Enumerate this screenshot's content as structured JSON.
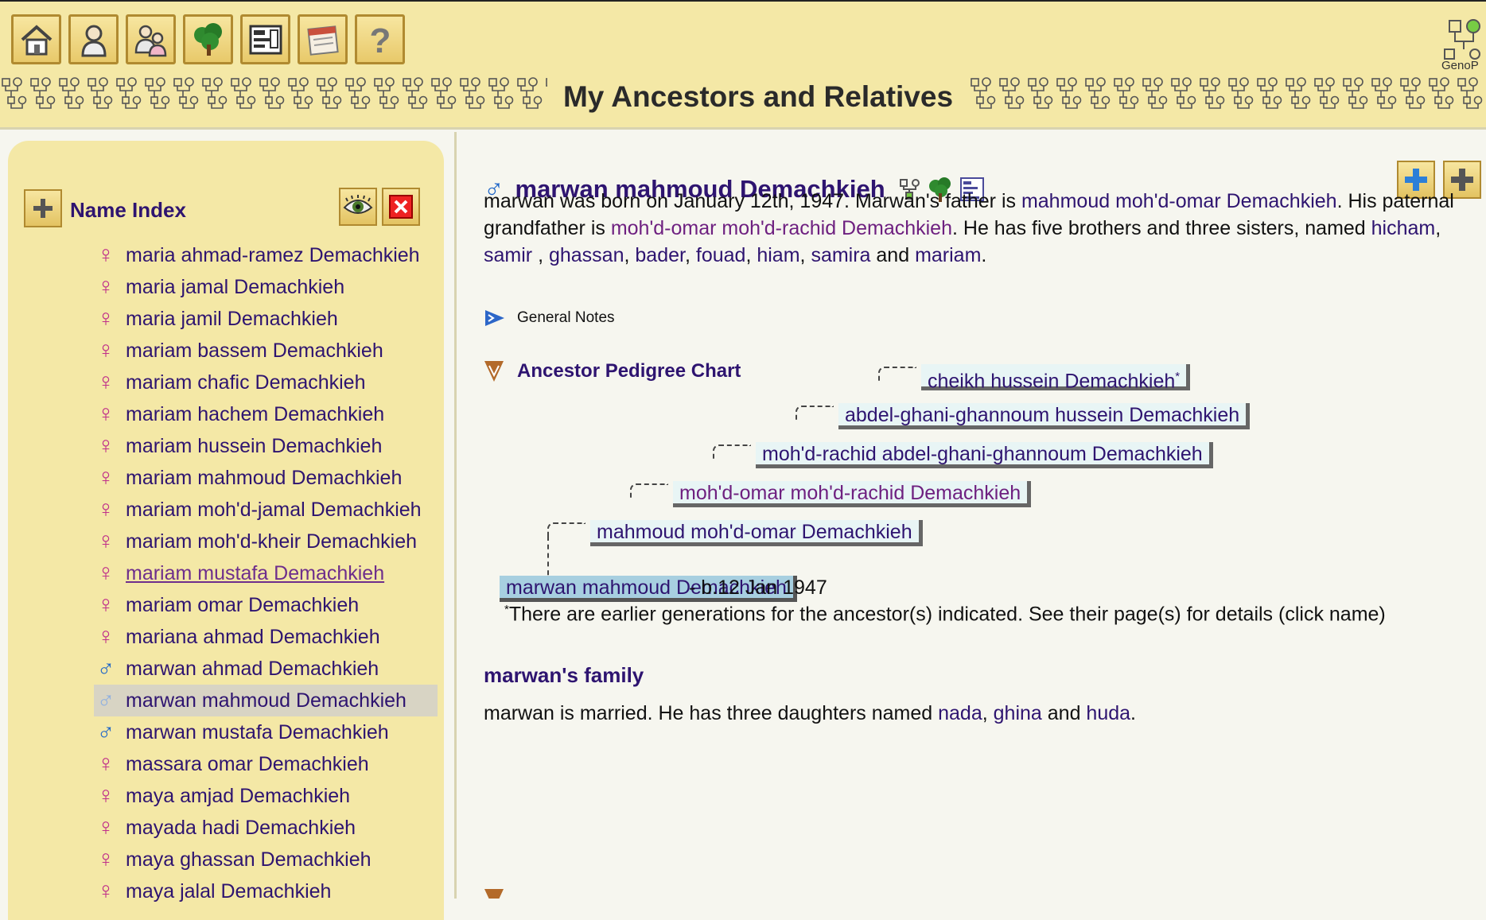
{
  "toolbar": {
    "buttons": [
      {
        "icon": "home-icon",
        "name": "toolbar-home-button"
      },
      {
        "icon": "person-icon",
        "name": "toolbar-individuals-button"
      },
      {
        "icon": "family-icon",
        "name": "toolbar-families-button"
      },
      {
        "icon": "tree-icon",
        "name": "toolbar-tree-button"
      },
      {
        "icon": "chart-icon",
        "name": "toolbar-charts-button"
      },
      {
        "icon": "calendar-icon",
        "name": "toolbar-calendar-button"
      },
      {
        "icon": "help-icon",
        "name": "toolbar-help-button"
      }
    ]
  },
  "header": {
    "title": "My Ancestors and Relatives",
    "logo_text": "GenoP"
  },
  "sidebar": {
    "title": "Name Index",
    "entries": [
      {
        "name": "maria ahmad-ramez Demachkieh",
        "gender": "f"
      },
      {
        "name": "maria jamal Demachkieh",
        "gender": "f"
      },
      {
        "name": "maria jamil Demachkieh",
        "gender": "f"
      },
      {
        "name": "mariam bassem Demachkieh",
        "gender": "f"
      },
      {
        "name": "mariam chafic Demachkieh",
        "gender": "f"
      },
      {
        "name": "mariam hachem Demachkieh",
        "gender": "f"
      },
      {
        "name": "mariam hussein Demachkieh",
        "gender": "f"
      },
      {
        "name": "mariam mahmoud Demachkieh",
        "gender": "f"
      },
      {
        "name": "mariam moh'd-jamal Demachkieh",
        "gender": "f"
      },
      {
        "name": "mariam moh'd-kheir Demachkieh",
        "gender": "f"
      },
      {
        "name": "mariam mustafa Demachkieh",
        "gender": "f",
        "state": "hover"
      },
      {
        "name": "mariam omar Demachkieh",
        "gender": "f"
      },
      {
        "name": "mariana ahmad Demachkieh",
        "gender": "f"
      },
      {
        "name": "marwan ahmad Demachkieh",
        "gender": "m"
      },
      {
        "name": "marwan mahmoud Demachkieh",
        "gender": "m",
        "state": "selected"
      },
      {
        "name": "marwan mustafa Demachkieh",
        "gender": "m"
      },
      {
        "name": "massara omar Demachkieh",
        "gender": "f"
      },
      {
        "name": "maya amjad Demachkieh",
        "gender": "f"
      },
      {
        "name": "mayada hadi Demachkieh",
        "gender": "f"
      },
      {
        "name": "maya ghassan Demachkieh",
        "gender": "f"
      },
      {
        "name": "maya jalal Demachkieh",
        "gender": "f"
      }
    ]
  },
  "person": {
    "gender_symbol": "♂",
    "name": "marwan mahmoud Demachkieh",
    "bio": {
      "t1": "marwan was born on January 12th, 1947.  Marwan's father is ",
      "father": "mahmoud moh'd-omar Demachkieh",
      "t2": ".  His paternal grandfather is ",
      "grandfather": "moh'd-omar moh'd-rachid Demachkieh",
      "t3": ". He has five brothers and three sisters, named ",
      "siblings": [
        "hicham",
        "samir ",
        "ghassan",
        "bader",
        "fouad",
        "hiam",
        "samira",
        "mariam"
      ],
      "and": "and",
      "end": "."
    }
  },
  "general_notes": {
    "label": "General Notes"
  },
  "pedigree": {
    "title": "Ancestor Pedigree Chart",
    "generations": [
      {
        "name": "cheikh hussein Demachkieh",
        "marker": "*"
      },
      {
        "name": "abdel-ghani-ghannoum hussein Demachkieh",
        "marker": ""
      },
      {
        "name": "moh'd-rachid abdel-ghani-ghannoum Demachkieh",
        "marker": ""
      },
      {
        "name": "moh'd-omar moh'd-rachid Demachkieh",
        "marker": ""
      },
      {
        "name": "mahmoud moh'd-omar Demachkieh",
        "marker": ""
      }
    ],
    "self": "marwan mahmoud Demachkieh",
    "self_birth": " - b.12 Jan 1947",
    "note_marker": "*",
    "note": "There are earlier generations for the ancestor(s) indicated. See their page(s) for details (click name)"
  },
  "family": {
    "title": "marwan's family",
    "t1": "marwan is married.  He has three daughters named ",
    "daughters": [
      "nada",
      "ghina",
      "huda"
    ],
    "and": "and",
    "end": "."
  },
  "colors": {
    "header_bg": "#f4e8a6",
    "link": "#2e1470",
    "visited_link": "#6e2080",
    "female_icon": "#c0308a",
    "male_icon": "#1f66c8",
    "pedigree_box": "#e8f5f5",
    "pedigree_self": "#a7cfe0"
  }
}
